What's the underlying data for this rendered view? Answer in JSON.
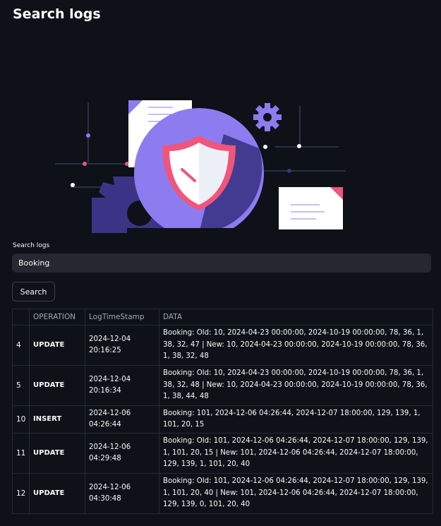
{
  "page": {
    "title": "Search logs"
  },
  "search": {
    "label": "Search logs",
    "value": "Booking",
    "button_label": "Search"
  },
  "table": {
    "columns": [
      "",
      "OPERATION",
      "LogTimeStamp",
      "DATA"
    ],
    "rows": [
      {
        "index": "4",
        "operation": "UPDATE",
        "timestamp": "2024-12-04 20:16:25",
        "data": "Booking: Old: 10, 2024-04-23 00:00:00, 2024-10-19 00:00:00, 78, 36, 1, 38, 32, 47 | New: 10, 2024-04-23 00:00:00, 2024-10-19 00:00:00, 78, 36, 1, 38, 32, 48"
      },
      {
        "index": "5",
        "operation": "UPDATE",
        "timestamp": "2024-12-04 20:16:34",
        "data": "Booking: Old: 10, 2024-04-23 00:00:00, 2024-10-19 00:00:00, 78, 36, 1, 38, 32, 48 | New: 10, 2024-04-23 00:00:00, 2024-10-19 00:00:00, 78, 36, 1, 38, 44, 48"
      },
      {
        "index": "10",
        "operation": "INSERT",
        "timestamp": "2024-12-06 04:26:44",
        "data": "Booking: 101, 2024-12-06 04:26:44, 2024-12-07 18:00:00, 129, 139, 1, 101, 20, 15"
      },
      {
        "index": "11",
        "operation": "UPDATE",
        "timestamp": "2024-12-06 04:29:48",
        "data": "Booking: Old: 101, 2024-12-06 04:26:44, 2024-12-07 18:00:00, 129, 139, 1, 101, 20, 15 | New: 101, 2024-12-06 04:26:44, 2024-12-07 18:00:00, 129, 139, 1, 101, 20, 40"
      },
      {
        "index": "12",
        "operation": "UPDATE",
        "timestamp": "2024-12-06 04:30:48",
        "data": "Booking: Old: 101, 2024-12-06 04:26:44, 2024-12-07 18:00:00, 129, 139, 1, 101, 20, 40 | New: 101, 2024-12-06 04:26:44, 2024-12-07 18:00:00, 129, 139, 0, 101, 20, 40"
      }
    ]
  },
  "colors": {
    "background": "#0e1117",
    "input_background": "#262730",
    "purple": "#8c7cf0",
    "dark_purple": "#3b3486",
    "pink": "#f0557a"
  },
  "icons": {
    "illustration": "security-shield-illustration",
    "gear": "gear-icon",
    "document": "document-icon"
  }
}
